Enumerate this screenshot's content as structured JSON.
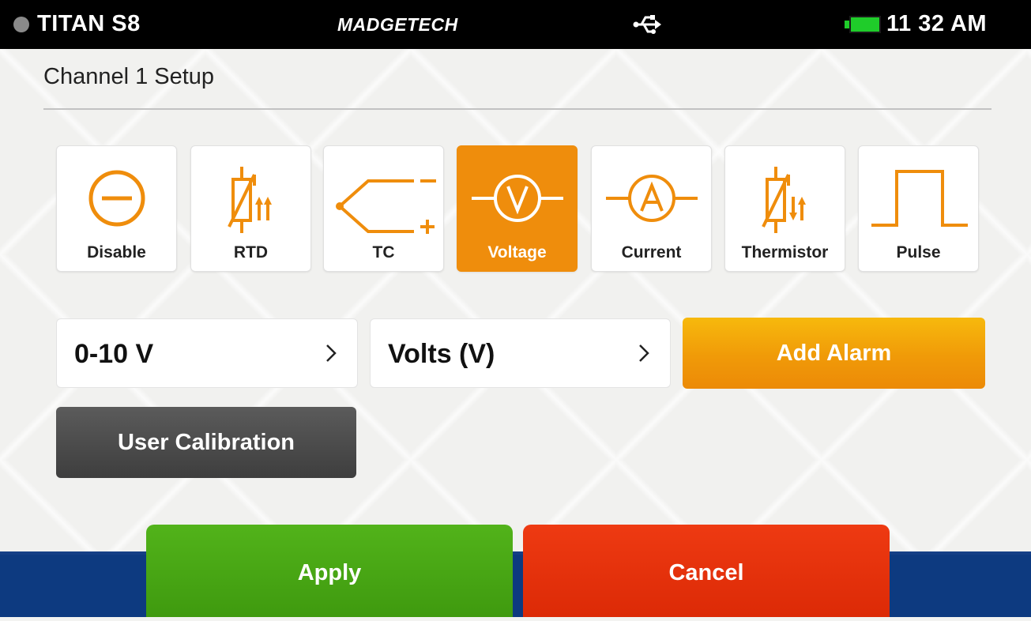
{
  "status_bar": {
    "device_name": "TITAN S8",
    "brand": "MADGETECH",
    "time": "11 32 AM",
    "usb_icon": "usb-icon",
    "battery_icon": "battery-icon",
    "battery_color": "#1fcc2a"
  },
  "page": {
    "title": "Channel 1 Setup"
  },
  "channel_types": [
    {
      "label": "Disable",
      "icon": "disable-icon",
      "selected": false
    },
    {
      "label": "RTD",
      "icon": "rtd-icon",
      "selected": false
    },
    {
      "label": "TC",
      "icon": "thermocouple-icon",
      "selected": false
    },
    {
      "label": "Voltage",
      "icon": "voltmeter-icon",
      "selected": true
    },
    {
      "label": "Current",
      "icon": "ammeter-icon",
      "selected": false
    },
    {
      "label": "Thermistor",
      "icon": "thermistor-icon",
      "selected": false
    },
    {
      "label": "Pulse",
      "icon": "pulse-icon",
      "selected": false
    }
  ],
  "range_selector": {
    "value": "0-10 V"
  },
  "unit_selector": {
    "value": "Volts (V)"
  },
  "buttons": {
    "add_alarm": "Add Alarm",
    "user_calibration": "User Calibration",
    "apply": "Apply",
    "cancel": "Cancel"
  },
  "colors": {
    "accent": "#ef8d0c",
    "apply": "#4aa814",
    "cancel": "#e4320a",
    "bottom_bar": "#0d3a80"
  }
}
